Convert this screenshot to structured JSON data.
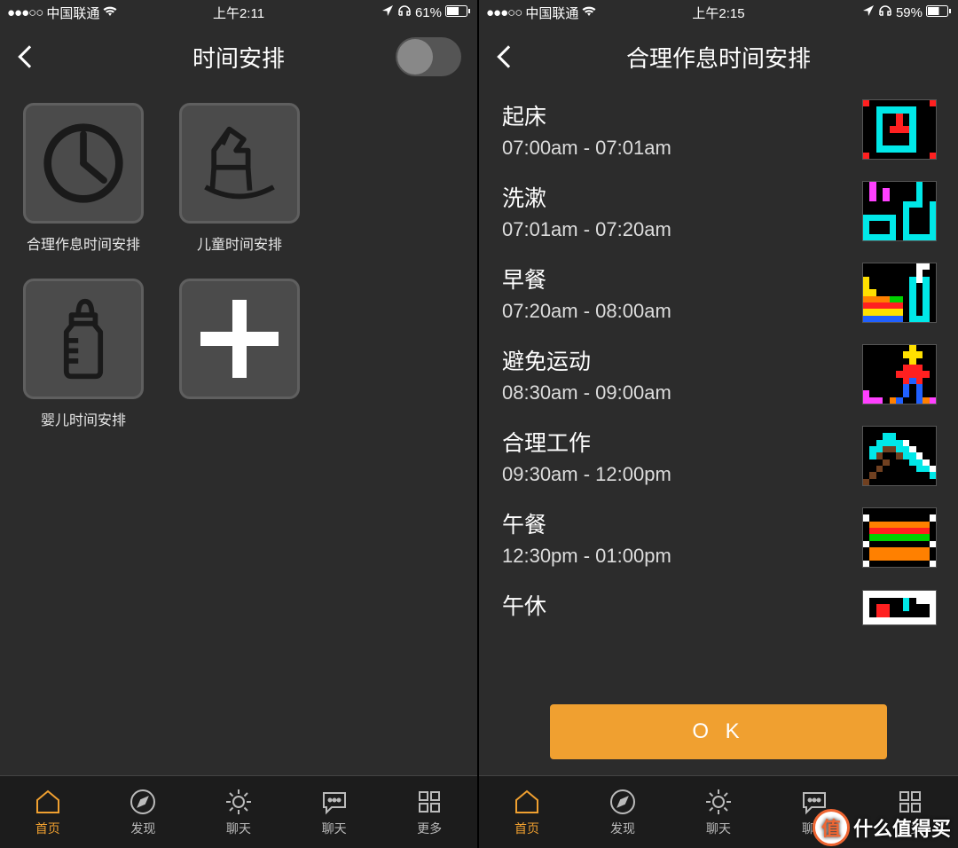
{
  "left": {
    "status": {
      "carrier": "中国联通",
      "time": "上午2:11",
      "battery": "61%"
    },
    "nav_title": "时间安排",
    "tiles": [
      {
        "label": "合理作息时间安排"
      },
      {
        "label": "儿童时间安排"
      },
      {
        "label": "婴儿时间安排"
      },
      {
        "label": ""
      }
    ]
  },
  "right": {
    "status": {
      "carrier": "中国联通",
      "time": "上午2:15",
      "battery": "59%"
    },
    "nav_title": "合理作息时间安排",
    "ok_label": "O K",
    "items": [
      {
        "title": "起床",
        "time": "07:00am - 07:01am"
      },
      {
        "title": "洗漱",
        "time": "07:01am - 07:20am"
      },
      {
        "title": "早餐",
        "time": "07:20am - 08:00am"
      },
      {
        "title": "避免运动",
        "time": "08:30am - 09:00am"
      },
      {
        "title": "合理工作",
        "time": "09:30am - 12:00pm"
      },
      {
        "title": "午餐",
        "time": "12:30pm - 01:00pm"
      },
      {
        "title": "午休",
        "time": ""
      }
    ]
  },
  "tabs": [
    {
      "label": "首页"
    },
    {
      "label": "发现"
    },
    {
      "label": "聊天"
    },
    {
      "label": "聊天"
    },
    {
      "label": "更多"
    }
  ],
  "watermark": "什么值得买"
}
